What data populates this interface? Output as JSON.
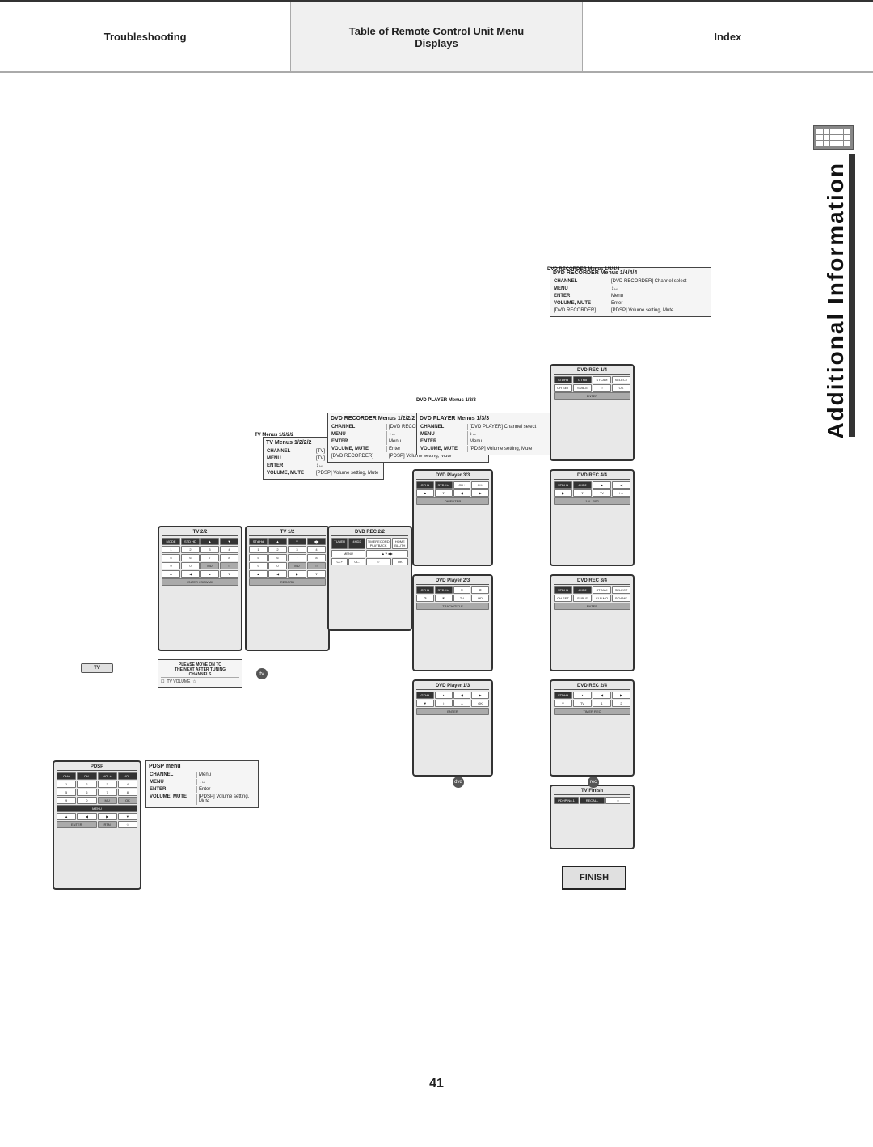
{
  "header": {
    "sections": [
      {
        "label": "Troubleshooting",
        "bold": true,
        "active": false
      },
      {
        "label": "Table of Remote Control Unit Menu\nDisplays",
        "bold": true,
        "active": true
      },
      {
        "label": "Index",
        "bold": true,
        "active": false
      }
    ]
  },
  "page": {
    "number": "41",
    "side_title": "Additional Information"
  },
  "pdsp": {
    "title": "PDSP menu",
    "channel": "CHANNEL",
    "menu": "MENU",
    "enter": "↕↔",
    "volume_mute": "VOLUME, MUTE",
    "sub_menu": "Menu",
    "sub_enter": "↕↔",
    "sub_channel": "[PDSP]",
    "sub_volume": "[PDSP] Volume setting,",
    "sub_mute": "Mute"
  },
  "tv": {
    "title": "TV",
    "menus": "TV Menus 1/2/2/2",
    "channel": "CHANNEL",
    "menu": "TV] Channel select",
    "enter": "TV] ↕↔",
    "volume_mute": "[PDSP] Volume setting, Mute"
  },
  "dvd_recorder_1": {
    "title": "DVD RECORDER Menus 1/2/2/2",
    "channel": "CHANNEL",
    "menu": "[DVD RECORDER] Channel select",
    "nav": "↕↔",
    "enter": "Menu",
    "volume_mute": "Enter"
  },
  "dvd_player": {
    "title": "DVD PLAYER Menus 1/3/3",
    "channel": "CHANNEL",
    "menu": "[DVD PLAYER] Channel select",
    "nav": "↕↔",
    "enter": "Menu",
    "volume_mute": "Enter"
  },
  "dvd_recorder_2": {
    "title": "DVD RECORDER Menus 1/4/4/4",
    "channel": "CHANNEL",
    "menu": "[DVD RECORDER] Channel select",
    "nav": "↕↔",
    "enter": "Menu",
    "volume_mute": "Enter"
  },
  "finish": {
    "label": "FINISH"
  },
  "page_number": "41"
}
